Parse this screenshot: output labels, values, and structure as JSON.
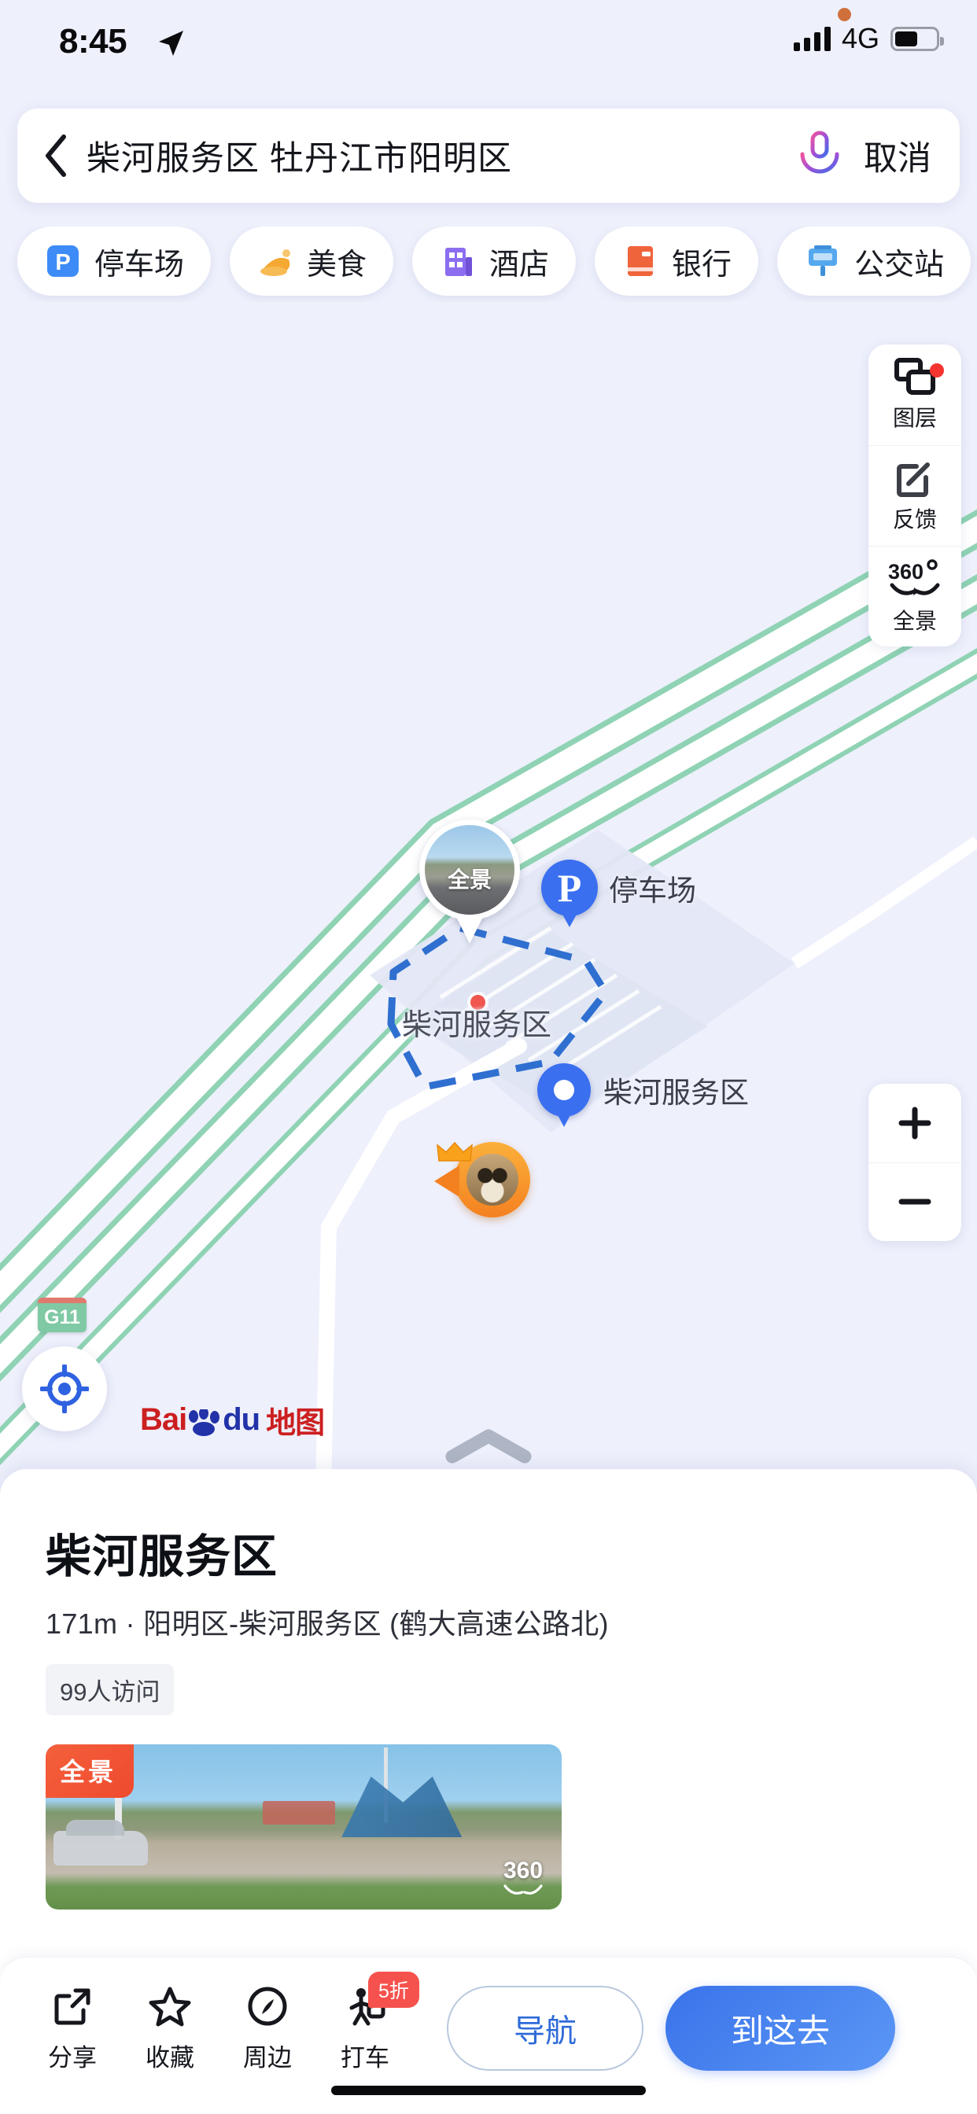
{
  "status_bar": {
    "time": "8:45",
    "location_icon": "location-arrow-icon",
    "recording_dot": "orange-recording-indicator",
    "network": "4G",
    "signal_icon": "signal-bars-icon",
    "battery_icon": "battery-icon",
    "battery_level": 55
  },
  "search": {
    "back_icon": "back-chevron-icon",
    "query": "柴河服务区 牡丹江市阳明区",
    "mic_icon": "microphone-icon",
    "cancel_label": "取消"
  },
  "chips": [
    {
      "label": "停车场",
      "icon": "parking-icon",
      "color": "#3d8bf7"
    },
    {
      "label": "美食",
      "icon": "food-icon",
      "color": "#f6a633"
    },
    {
      "label": "酒店",
      "icon": "hotel-icon",
      "color": "#8b6df0"
    },
    {
      "label": "银行",
      "icon": "bank-icon",
      "color": "#f0643c"
    },
    {
      "label": "公交站",
      "icon": "bus-stop-icon",
      "color": "#56a8ee"
    }
  ],
  "map_tools": [
    {
      "label": "图层",
      "icon": "layers-icon",
      "badge": true
    },
    {
      "label": "反馈",
      "icon": "feedback-edit-icon",
      "badge": false
    },
    {
      "label": "全景",
      "icon": "360-panorama-icon",
      "badge": false
    }
  ],
  "zoom_controls": {
    "zoom_in": "+",
    "zoom_out": "−"
  },
  "locate_icon": "my-location-icon",
  "logo": {
    "bai": "Bai",
    "du": "du",
    "map": "地图"
  },
  "map_markers": {
    "panorama_pin_label": "全景",
    "parking_marker_label": "停车场",
    "parking_marker_glyph": "P",
    "area_label": "柴河服务区",
    "poi_marker_label": "柴河服务区",
    "highway_shield": "G11",
    "my_location_icon": "user-avatar-location-icon"
  },
  "sheet": {
    "title": "柴河服务区",
    "subtitle": "171m · 阳明区-柴河服务区 (鹤大高速公路北)",
    "distance": "171m",
    "visits_badge": "99人访问",
    "panorama_card": {
      "badge": "全景",
      "corner_label": "360"
    },
    "handle_icon": "chevron-up-handle-icon"
  },
  "actions": [
    {
      "label": "分享",
      "icon": "share-icon",
      "badge": null
    },
    {
      "label": "收藏",
      "icon": "star-icon",
      "badge": null
    },
    {
      "label": "周边",
      "icon": "compass-nearby-icon",
      "badge": null
    },
    {
      "label": "打车",
      "icon": "taxi-icon",
      "badge": "5折"
    }
  ],
  "primary_buttons": {
    "nav_label": "导航",
    "go_label": "到这去"
  },
  "colors": {
    "accent_blue": "#3a6ff0",
    "map_background": "#eef0fc",
    "road_green": "#8fd3b4",
    "badge_red": "#f6524d",
    "brand_red": "#cc1f20",
    "brand_blue": "#2232a8"
  }
}
